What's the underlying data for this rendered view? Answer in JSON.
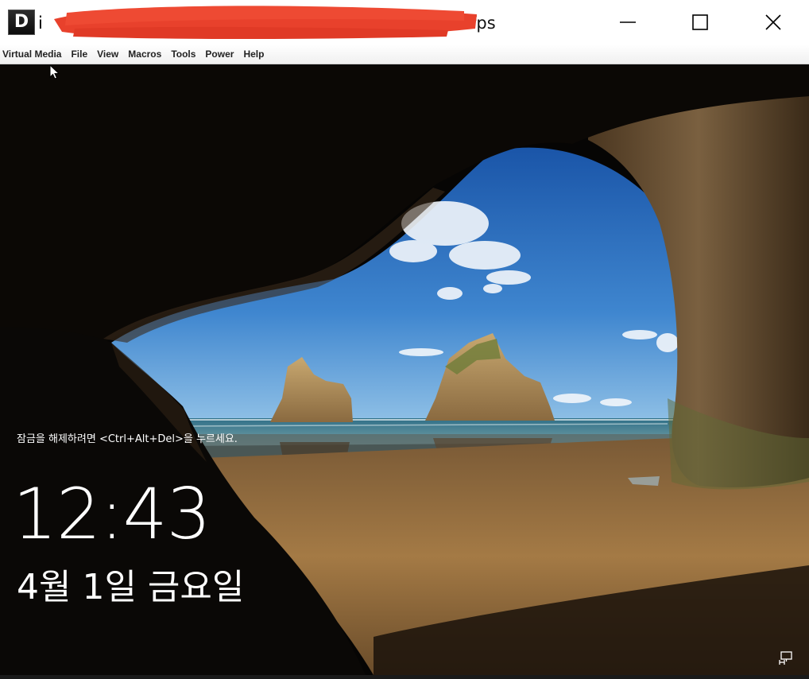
{
  "window": {
    "app_icon_letter": "D",
    "title_prefix": "i",
    "title_suffix": "fps",
    "controls": {
      "minimize": "minimize-icon",
      "maximize": "maximize-icon",
      "close": "close-icon"
    }
  },
  "menubar": {
    "items": [
      "Virtual Media",
      "File",
      "View",
      "Macros",
      "Tools",
      "Power",
      "Help"
    ]
  },
  "lockscreen": {
    "unlock_hint": "잠금을 해제하려면 <Ctrl+Alt+Del>을 누르세요.",
    "time": "12:43",
    "date": "4월 1일 금요일",
    "network_icon": "network-icon"
  },
  "colors": {
    "redaction": "#e8412c",
    "sky": "#2e6fb8",
    "sand": "#9a6f3c",
    "cave_rock": "#3a2a1a"
  }
}
